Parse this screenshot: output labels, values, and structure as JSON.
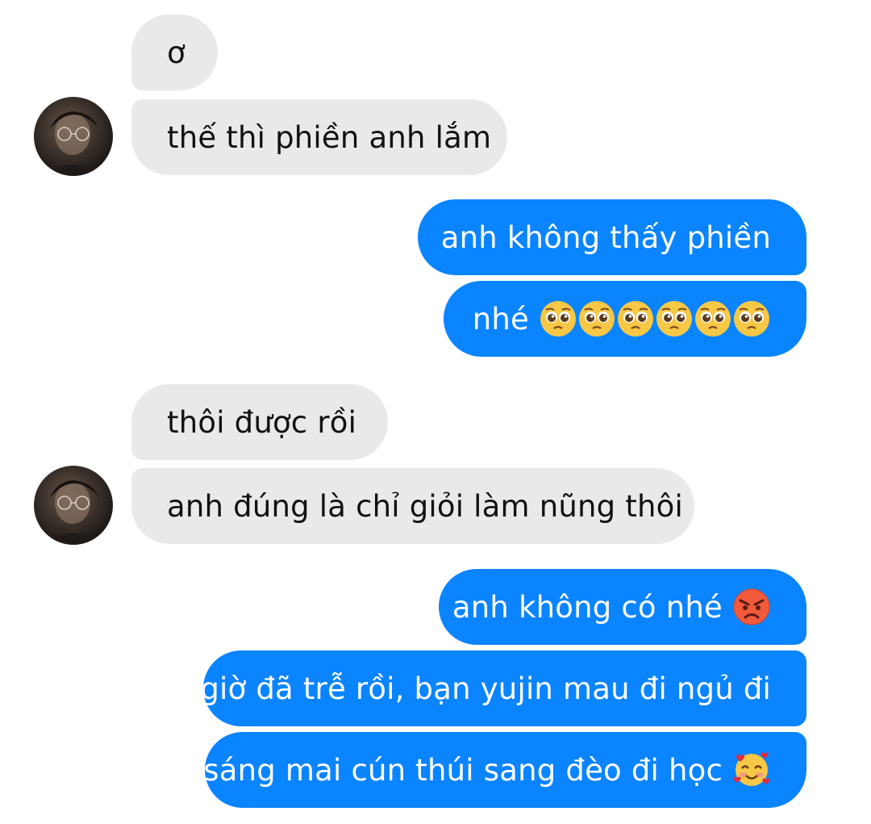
{
  "thread": {
    "messages": [
      {
        "from": "other",
        "text": "ơ"
      },
      {
        "from": "other",
        "text": "thế thì phiền anh lắm"
      },
      {
        "from": "me",
        "text": "anh không thấy phiền"
      },
      {
        "from": "me",
        "text": "nhé",
        "emoji": [
          "pleading-face",
          "pleading-face",
          "pleading-face",
          "pleading-face",
          "pleading-face",
          "pleading-face"
        ]
      },
      {
        "from": "other",
        "text": "thôi được rồi"
      },
      {
        "from": "other",
        "text": "anh đúng là chỉ giỏi làm nũng thôi"
      },
      {
        "from": "me",
        "text": "anh không có nhé",
        "emoji": [
          "angry-face"
        ]
      },
      {
        "from": "me",
        "text": "giờ đã trễ rồi, bạn yujin mau đi ngủ đi"
      },
      {
        "from": "me",
        "text": "sáng mai cún thúi sang đèo đi học",
        "emoji": [
          "smiling-face-with-hearts"
        ]
      }
    ]
  },
  "colors": {
    "incoming_bubble": "#e9e9e9",
    "outgoing_bubble": "#0a84ff",
    "incoming_text": "#111111",
    "outgoing_text": "#ffffff"
  }
}
